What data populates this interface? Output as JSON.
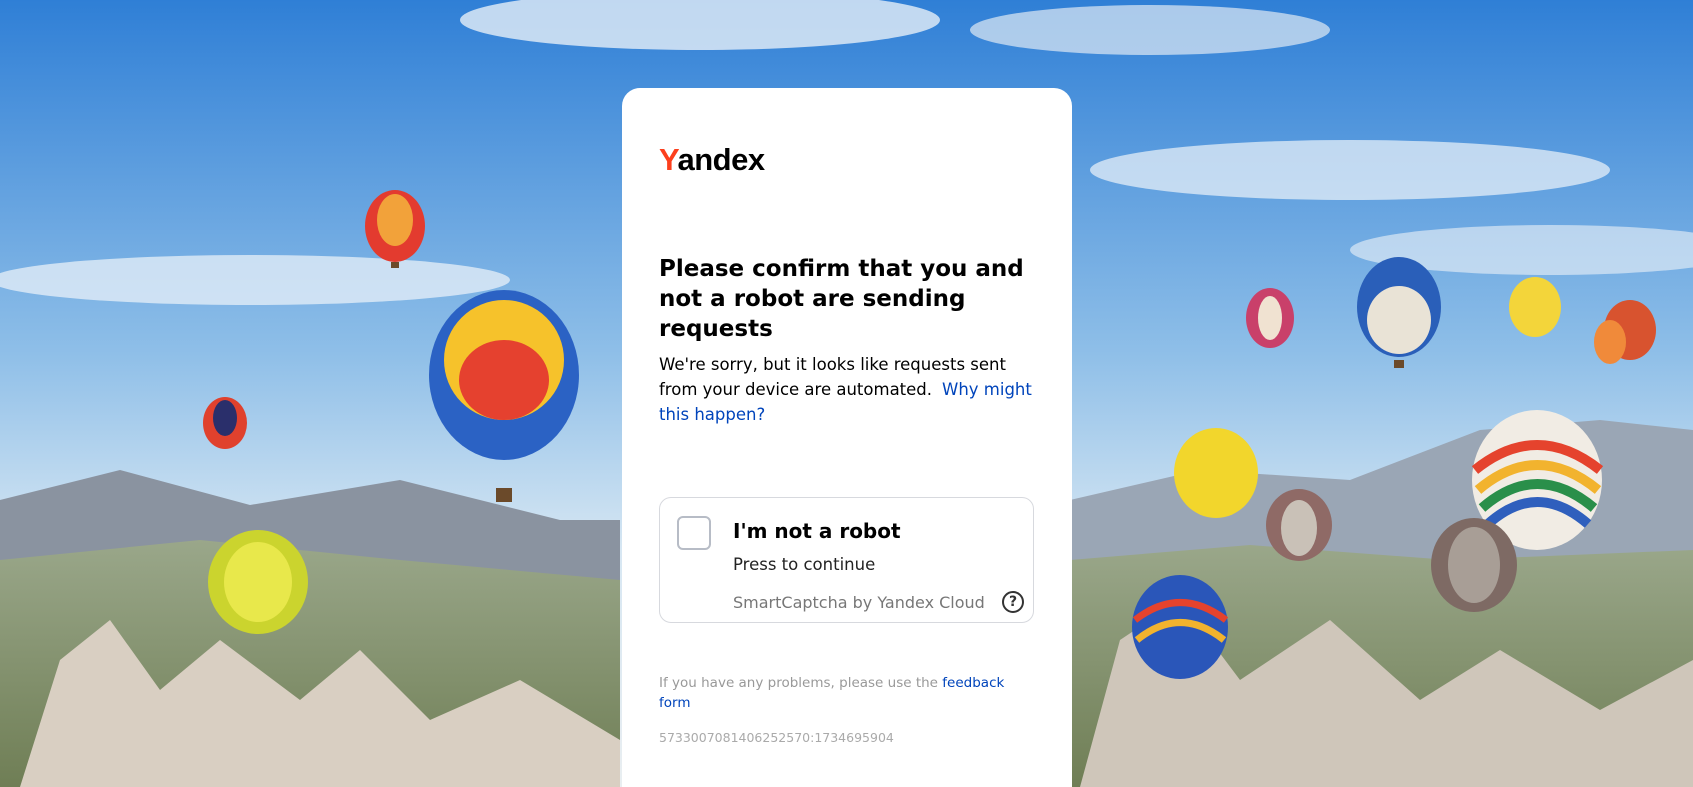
{
  "logo": {
    "first_letter": "Y",
    "rest": "andex"
  },
  "title": "Please confirm that you and not a robot are sending requests",
  "description": {
    "text": "We're sorry, but it looks like requests sent from your device are automated.",
    "link": "Why might this happen?"
  },
  "captcha": {
    "title": "I'm not a robot",
    "subtitle": "Press to continue",
    "brand": "SmartCaptcha by Yandex Cloud",
    "help_glyph": "?",
    "checked": false
  },
  "footer": {
    "text": "If you have any problems, please use the",
    "link": "feedback form"
  },
  "request_id": "5733007081406252570:1734695904",
  "colors": {
    "brand_red": "#fc3f1d",
    "link_blue": "#0044bb",
    "sky_top": "#3a86d4",
    "sky_bottom": "#cfe3f4"
  },
  "background": {
    "description_icon": "hot-air-balloons-landscape"
  }
}
